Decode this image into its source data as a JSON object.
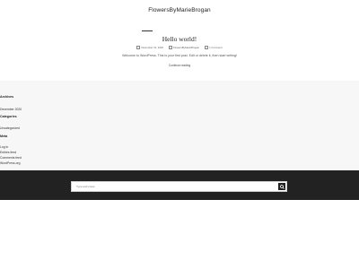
{
  "site": {
    "title": "FlowersByMarieBrogan"
  },
  "post": {
    "title": "Hello world!",
    "meta": {
      "date": "December 31, 2020",
      "author": "FlowersByMarieBrogan",
      "comments": "1 Comment"
    },
    "excerpt": "Welcome to WordPress. This is your first post. Edit or delete it, then start writing!",
    "continue_label": "Continue reading"
  },
  "sidebar": {
    "archives": {
      "heading": "Archives",
      "items": [
        "December 2020"
      ]
    },
    "categories": {
      "heading": "Categories",
      "items": [
        "Uncategorized"
      ]
    },
    "meta": {
      "heading": "Meta",
      "items": [
        "Log in",
        "Entries feed",
        "Comments feed",
        "WordPress.org"
      ]
    }
  },
  "footer": {
    "search_placeholder": "Type and press"
  },
  "colors": {
    "footer_bg": "#222222",
    "widget_bg": "#f7f7f7",
    "text": "#333333"
  }
}
